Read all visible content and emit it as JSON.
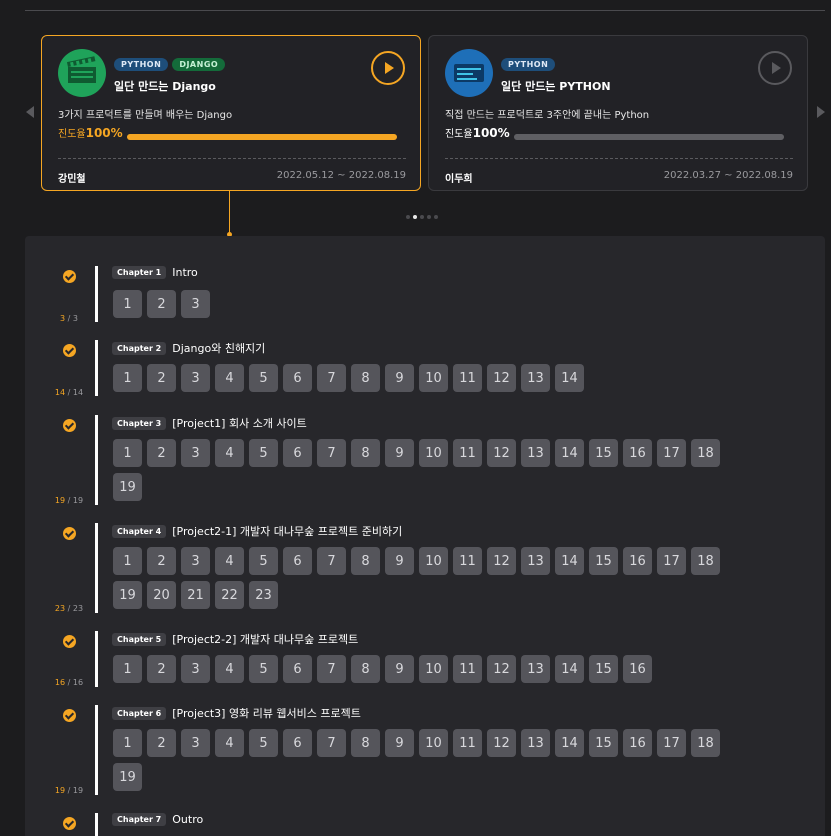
{
  "courses": [
    {
      "tags": [
        "PYTHON",
        "DJANGO"
      ],
      "title": "일단 만드는 Django",
      "description": "3가지 프로덕트를 만들며 배우는 Django",
      "progress_label": "진도율",
      "progress_value": "100%",
      "progress_fraction": 1.0,
      "author": "강민철",
      "period": "2022.05.12 ~ 2022.08.19"
    },
    {
      "tags": [
        "PYTHON"
      ],
      "title": "일단 만드는 PYTHON",
      "description": "직접 만드는 프로덕트로 3주안에 끝내는 Python",
      "progress_label": "진도율",
      "progress_value": "100%",
      "progress_fraction": 1.0,
      "author": "이두희",
      "period": "2022.03.27 ~ 2022.08.19"
    }
  ],
  "chapters": [
    {
      "chip": "Chapter 1",
      "title": "Intro",
      "done": "3",
      "total": "3",
      "lessons": 3
    },
    {
      "chip": "Chapter 2",
      "title": "Django와 친해지기",
      "done": "14",
      "total": "14",
      "lessons": 14
    },
    {
      "chip": "Chapter 3",
      "title": "[Project1] 회사 소개 사이트",
      "done": "19",
      "total": "19",
      "lessons": 19
    },
    {
      "chip": "Chapter 4",
      "title": "[Project2-1] 개발자 대나무숲 프로젝트 준비하기",
      "done": "23",
      "total": "23",
      "lessons": 23
    },
    {
      "chip": "Chapter 5",
      "title": "[Project2-2] 개발자 대나무숲 프로젝트",
      "done": "16",
      "total": "16",
      "lessons": 16
    },
    {
      "chip": "Chapter 6",
      "title": "[Project3] 영화 리뷰 웹서비스 프로젝트",
      "done": "19",
      "total": "19",
      "lessons": 19
    },
    {
      "chip": "Chapter 7",
      "title": "Outro",
      "done": "",
      "total": "",
      "lessons": 0
    }
  ],
  "colors": {
    "accent": "#f5a623",
    "python_tag": "#1e4e7a",
    "django_tag": "#146b3a"
  },
  "icons": {
    "play": "play-icon",
    "check": "check-circle-icon",
    "prev": "chevron-left-icon",
    "next": "chevron-right-icon"
  }
}
